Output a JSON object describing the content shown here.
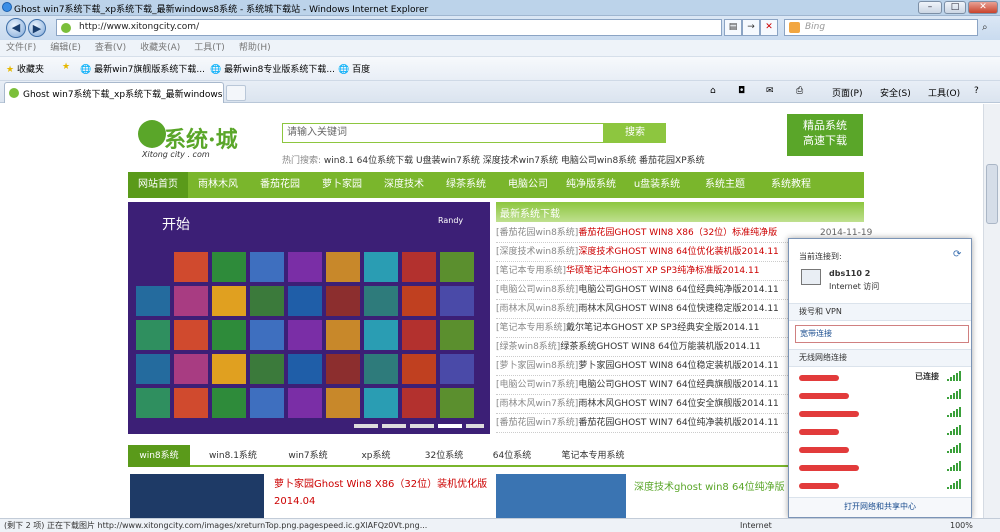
{
  "window": {
    "title": "Ghost win7系统下载_xp系统下载_最新windows8系统 - 系统城下载站 - Windows Internet Explorer"
  },
  "address": {
    "url": "http://www.xitongcity.com/",
    "search_placeholder": "Bing"
  },
  "menu": [
    "文件(F)",
    "编辑(E)",
    "查看(V)",
    "收藏夹(A)",
    "工具(T)",
    "帮助(H)"
  ],
  "favorites": {
    "label": "收藏夹",
    "items": [
      "最新win7旗舰版系统下载...",
      "最新win8专业版系统下载...",
      "百度"
    ]
  },
  "tab": {
    "title": "Ghost win7系统下载_xp系统下载_最新windows..."
  },
  "commands": {
    "page": "页面(P)",
    "safety": "安全(S)",
    "tools": "工具(O)"
  },
  "site": {
    "logo": "系统·城",
    "logo_sub": "Xitong city . com",
    "search_placeholder": "请输入关键词",
    "search_button": "搜索",
    "hot_label": "热门搜索:",
    "hot_items": [
      "win8.1 64位系统下载",
      "U盘装win7系统",
      "深度技术win7系统",
      "电脑公司win8系统",
      "番茄花园XP系统"
    ],
    "badge_line1": "精品系统",
    "badge_line2": "高速下载",
    "nav": [
      "网站首页",
      "雨林木风",
      "番茄花园",
      "萝卜家园",
      "深度技术",
      "绿茶系统",
      "电脑公司",
      "纯净版系统",
      "u盘装系统",
      "系统主题",
      "系统教程"
    ],
    "banner_start": "开始",
    "banner_user": "Randy",
    "latest_title": "最新系统下载",
    "latest_date": "2014-11-19",
    "latest": [
      {
        "cat": "[番茄花园win8系统]",
        "title": "番茄花园GHOST WIN8 X86（32位）标准纯净版",
        "hot": true
      },
      {
        "cat": "[深度技术win8系统]",
        "title": "深度技术GHOST WIN8 64位优化装机版2014.11",
        "hot": true
      },
      {
        "cat": "[笔记本专用系统]",
        "title": "华硕笔记本GHOST XP SP3纯净标准版2014.11",
        "hot": true
      },
      {
        "cat": "[电脑公司win8系统]",
        "title": "电脑公司GHOST WIN8 64位经典纯净版2014.11",
        "hot": false
      },
      {
        "cat": "[雨林木风win8系统]",
        "title": "雨林木风GHOST WIN8 64位快速稳定版2014.11",
        "hot": false
      },
      {
        "cat": "[笔记本专用系统]",
        "title": "戴尔笔记本GHOST XP SP3经典安全版2014.11",
        "hot": false
      },
      {
        "cat": "[绿茶win8系统]",
        "title": "绿茶系统GHOST WIN8 64位万能装机版2014.11",
        "hot": false
      },
      {
        "cat": "[萝卜家园win8系统]",
        "title": "萝卜家园GHOST WIN8 64位稳定装机版2014.11",
        "hot": false
      },
      {
        "cat": "[电脑公司win7系统]",
        "title": "电脑公司GHOST WIN7 64位经典旗舰版2014.11",
        "hot": false
      },
      {
        "cat": "[雨林木风win7系统]",
        "title": "雨林木风GHOST WIN7 64位安全旗舰版2014.11",
        "hot": false
      },
      {
        "cat": "[番茄花园win7系统]",
        "title": "番茄花园GHOST WIN7 64位纯净装机版2014.11",
        "hot": false
      }
    ],
    "tabs": [
      "win8系统",
      "win8.1系统",
      "win7系统",
      "xp系统",
      "32位系统",
      "64位系统",
      "笔记本专用系统"
    ],
    "article1": "萝卜家园Ghost Win8 X86（32位）装机优化版2014.04",
    "article2": "深度技术ghost win8 64位纯净版"
  },
  "network": {
    "current_label": "当前连接到:",
    "conn_name": "dbs110  2",
    "conn_status": "Internet 访问",
    "dialup": "拨号和 VPN",
    "broadband": "宽带连接",
    "wireless": "无线网络连接",
    "connected": "已连接",
    "footer": "打开网络和共享中心"
  },
  "status": {
    "text": "(剩下 2 项) 正在下载图片 http://www.xitongcity.com/images/xreturnTop.png.pagespeed.ic.gXlAFQz0Vt.png...",
    "zone": "Internet",
    "zoom": "100%"
  }
}
